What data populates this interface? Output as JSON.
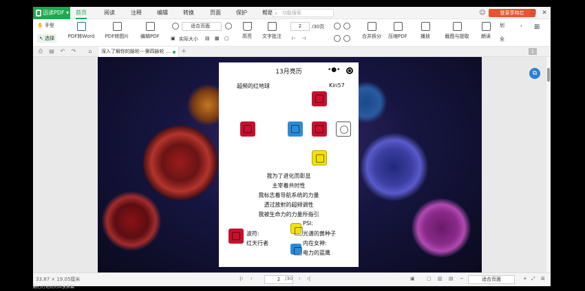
{
  "app": {
    "logo": "迅读PDF",
    "logo_caret": "▾"
  },
  "menu": [
    "首页",
    "阅读",
    "注释",
    "编辑",
    "转换",
    "页面",
    "保护",
    "帮助"
  ],
  "search": {
    "placeholder": "功能搜索"
  },
  "login": "登录享特权",
  "window": {
    "min": "—",
    "restore": "❐",
    "close": "✕",
    "skin": "☺"
  },
  "toolbar": {
    "hand": "手型",
    "select": "选择",
    "pdf_word": "PDF转Word",
    "pdf_image": "PDF转图片",
    "edit_pdf": "编辑PDF",
    "fit": "适合页面",
    "actual": "实际大小",
    "highlight": "高亮",
    "text_note": "文字批注",
    "page": "2",
    "pages": "/30页",
    "merge": "合并拆分",
    "compress": "压缩PDF",
    "play": "播放",
    "capture": "截图与提取",
    "read": "朗读",
    "tiny_a": "划",
    "tiny_b": "全"
  },
  "tab": {
    "label": "深入了解你的脉轮---第四脉轮 ...",
    "page_badge": "1",
    "new": "+"
  },
  "card": {
    "title": "13月亮历",
    "dots": "•●•",
    "subtitle": "超频的红地球",
    "kin": "Kin57",
    "lines": [
      "我为了进化而彰显",
      "主宰着共时性",
      "我标志着导航系统的力量",
      "透过放射的超频调性",
      "我被生命力的力量所指引"
    ],
    "wave_label": "波符:",
    "wave_value": "红天行者",
    "psi_label": "PSI:",
    "psi_value": "光谱的黄种子",
    "goddess_label": "内在女神:",
    "goddess_value": "电力的蓝鹰"
  },
  "status": {
    "size": "33.87 × 19.05厘米",
    "page": "2",
    "total": "/30",
    "zoom": "适合页面",
    "first": "|‹",
    "prev": "‹",
    "next": "›",
    "last": "›|"
  },
  "caption": "副心灯地对的共享屏幕",
  "colors": {
    "brand": "#1fa84f",
    "login": "#e9532f",
    "glyph_red": "#c8102e",
    "glyph_blue": "#2b8bd8",
    "glyph_yellow": "#f3e100"
  }
}
